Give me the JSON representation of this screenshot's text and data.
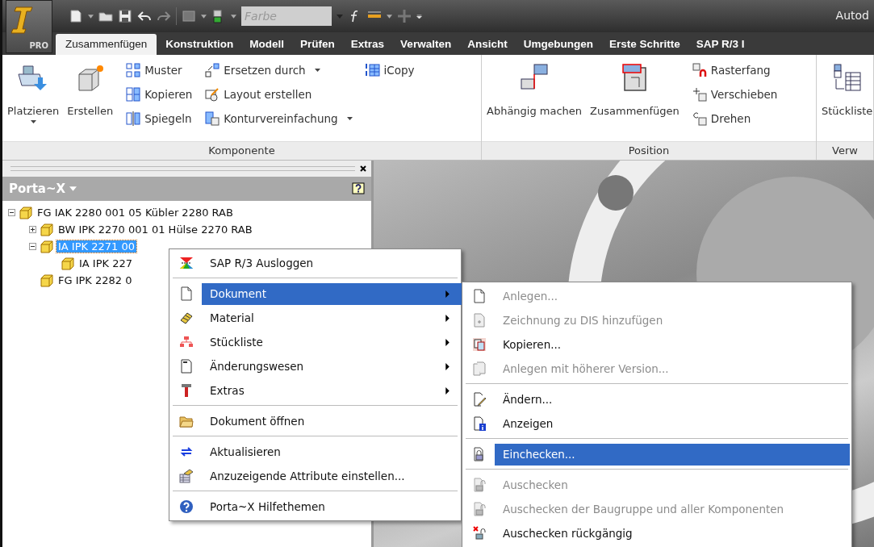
{
  "title_bar": {
    "app_badge": "PRO",
    "color_field": {
      "placeholder": "Farbe"
    },
    "title": "Autod"
  },
  "tabs": [
    {
      "label": "Zusammenfügen",
      "selected": true
    },
    {
      "label": "Konstruktion",
      "selected": false
    },
    {
      "label": "Modell",
      "selected": false
    },
    {
      "label": "Prüfen",
      "selected": false
    },
    {
      "label": "Extras",
      "selected": false
    },
    {
      "label": "Verwalten",
      "selected": false
    },
    {
      "label": "Ansicht",
      "selected": false
    },
    {
      "label": "Umgebungen",
      "selected": false
    },
    {
      "label": "Erste Schritte",
      "selected": false
    },
    {
      "label": "SAP R/3 I",
      "selected": false
    }
  ],
  "ribbon": {
    "panels": [
      {
        "title": "Komponente",
        "large": [
          {
            "label": "Platzieren",
            "dropdown": true
          },
          {
            "label": "Erstellen",
            "dropdown": false
          }
        ],
        "columns": [
          [
            {
              "label": "Muster",
              "dropdown": false
            },
            {
              "label": "Kopieren",
              "dropdown": false
            },
            {
              "label": "Spiegeln",
              "dropdown": false
            }
          ],
          [
            {
              "label": "Ersetzen durch",
              "dropdown": true
            },
            {
              "label": "Layout erstellen",
              "dropdown": false
            },
            {
              "label": "Konturvereinfachung",
              "dropdown": true
            }
          ],
          [
            {
              "label": "iCopy",
              "dropdown": false
            }
          ]
        ]
      },
      {
        "title": "Position",
        "large": [
          {
            "label": "Abhängig machen",
            "dropdown": false
          },
          {
            "label": "Zusammenfügen",
            "dropdown": false
          }
        ],
        "columns": [
          [
            {
              "label": "Rasterfang",
              "dropdown": false
            },
            {
              "label": "Verschieben",
              "dropdown": false
            },
            {
              "label": "Drehen",
              "dropdown": false
            }
          ]
        ]
      },
      {
        "title": "Verw",
        "large": [
          {
            "label": "Stückliste",
            "dropdown": false
          }
        ]
      }
    ]
  },
  "browser": {
    "title": "Porta~X",
    "tree": [
      {
        "label": "FG IAK 2280 001 05 Kübler 2280 RAB",
        "expanded": true,
        "selected": false,
        "children": [
          {
            "label": "BW IPK 2270 001 01 Hülse 2270 RAB",
            "expanded": false,
            "selected": false
          },
          {
            "label": "IA IPK 2271 00",
            "expanded": true,
            "selected": true,
            "children": [
              {
                "label": "IA IPK 227",
                "selected": false
              }
            ]
          },
          {
            "label": "FG IPK 2282 0",
            "selected": false
          }
        ]
      }
    ]
  },
  "context_menu": {
    "items": [
      {
        "kind": "item",
        "label": "SAP R/3 Ausloggen",
        "submenu": false,
        "selected": false
      },
      {
        "kind": "separator"
      },
      {
        "kind": "item",
        "label": "Dokument",
        "submenu": true,
        "selected": true
      },
      {
        "kind": "item",
        "label": "Material",
        "submenu": true,
        "selected": false
      },
      {
        "kind": "item",
        "label": "Stückliste",
        "submenu": true,
        "selected": false
      },
      {
        "kind": "item",
        "label": "Änderungswesen",
        "submenu": true,
        "selected": false
      },
      {
        "kind": "item",
        "label": "Extras",
        "submenu": true,
        "selected": false
      },
      {
        "kind": "separator"
      },
      {
        "kind": "item",
        "label": "Dokument öffnen",
        "submenu": false,
        "selected": false
      },
      {
        "kind": "separator"
      },
      {
        "kind": "item",
        "label": "Aktualisieren",
        "submenu": false,
        "selected": false
      },
      {
        "kind": "item",
        "label": "Anzuzeigende Attribute einstellen...",
        "submenu": false,
        "selected": false
      },
      {
        "kind": "separator"
      },
      {
        "kind": "item",
        "label": "Porta~X Hilfethemen",
        "submenu": false,
        "selected": false
      }
    ]
  },
  "submenu": {
    "items": [
      {
        "kind": "item",
        "label": "Anlegen...",
        "disabled": true,
        "selected": false
      },
      {
        "kind": "item",
        "label": "Zeichnung zu DIS hinzufügen",
        "disabled": true,
        "selected": false
      },
      {
        "kind": "item",
        "label": "Kopieren...",
        "disabled": false,
        "selected": false
      },
      {
        "kind": "item",
        "label": "Anlegen mit höherer Version...",
        "disabled": true,
        "selected": false
      },
      {
        "kind": "separator"
      },
      {
        "kind": "item",
        "label": "Ändern...",
        "disabled": false,
        "selected": false
      },
      {
        "kind": "item",
        "label": "Anzeigen",
        "disabled": false,
        "selected": false
      },
      {
        "kind": "separator"
      },
      {
        "kind": "item",
        "label": "Einchecken...",
        "disabled": false,
        "selected": true
      },
      {
        "kind": "separator"
      },
      {
        "kind": "item",
        "label": "Auschecken",
        "disabled": true,
        "selected": false
      },
      {
        "kind": "item",
        "label": "Auschecken der Baugruppe und aller Komponenten",
        "disabled": true,
        "selected": false
      },
      {
        "kind": "item",
        "label": "Auschecken rückgängig",
        "disabled": false,
        "selected": false
      }
    ]
  }
}
